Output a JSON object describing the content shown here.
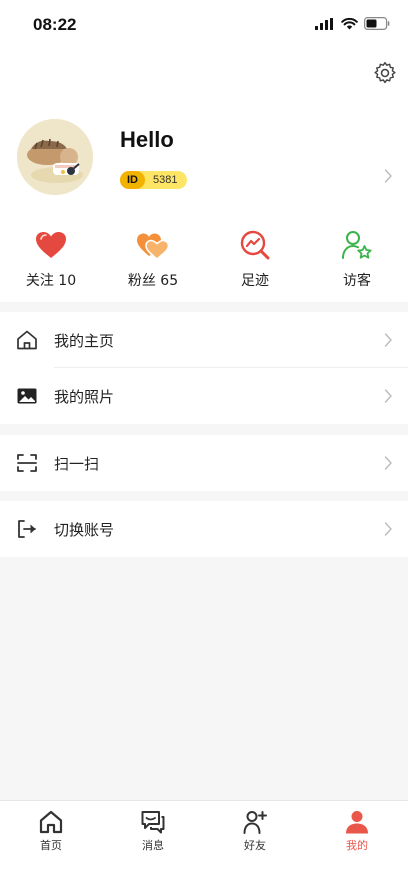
{
  "status_bar": {
    "time": "08:22"
  },
  "profile": {
    "name": "Hello",
    "id_tag": "ID",
    "id_value": "5381"
  },
  "stats": [
    {
      "label": "关注 10",
      "icon": "heart-icon",
      "color": "#e5483f"
    },
    {
      "label": "粉丝 65",
      "icon": "double-heart-icon",
      "color": "#f5903a"
    },
    {
      "label": "足迹",
      "icon": "trend-search-icon",
      "color": "#e5483f"
    },
    {
      "label": "访客",
      "icon": "user-star-icon",
      "color": "#3bb34a"
    }
  ],
  "menu": {
    "homepage": "我的主页",
    "photos": "我的照片",
    "scan": "扫一扫",
    "switch_account": "切换账号"
  },
  "tab_bar": [
    {
      "label": "首页",
      "icon": "home-icon"
    },
    {
      "label": "消息",
      "icon": "message-icon"
    },
    {
      "label": "好友",
      "icon": "add-friend-icon"
    },
    {
      "label": "我的",
      "icon": "me-icon",
      "active": true
    }
  ],
  "colors": {
    "accent": "#e8574a",
    "id_pill": "#ffe566",
    "id_tag": "#f2b200"
  }
}
